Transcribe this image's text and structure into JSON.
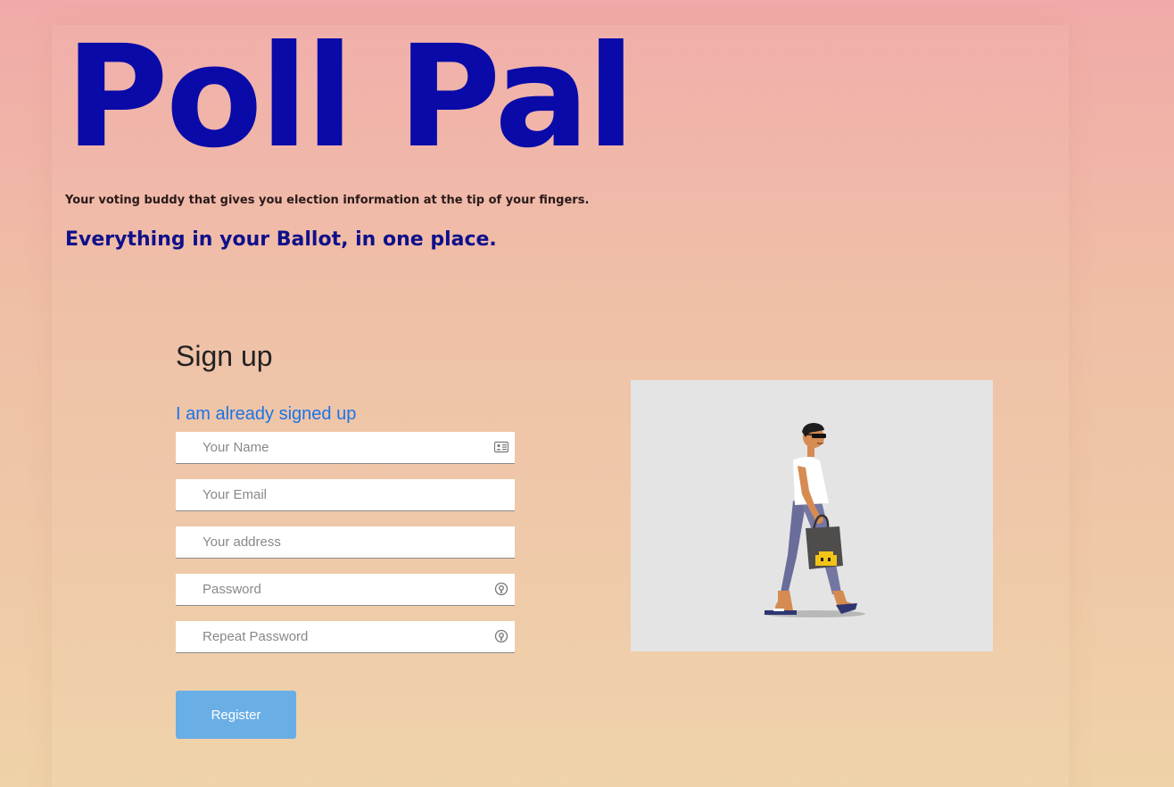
{
  "brand": {
    "title": "Poll Pal",
    "tagline": "Your voting buddy that gives you election information at the tip of your fingers.",
    "headline": "Everything in your Ballot, in one place."
  },
  "signup": {
    "title": "Sign up",
    "login_link": "I am already signed up",
    "fields": {
      "name": {
        "placeholder": "Your Name",
        "value": "",
        "icon": "contact-card-icon"
      },
      "email": {
        "placeholder": "Your Email",
        "value": ""
      },
      "address": {
        "placeholder": "Your address",
        "value": ""
      },
      "password": {
        "placeholder": "Password",
        "value": "",
        "icon": "password-reveal-icon"
      },
      "repeat_password": {
        "placeholder": "Repeat Password",
        "value": "",
        "icon": "password-reveal-icon"
      }
    },
    "register_label": "Register"
  },
  "illustration": {
    "subject": "walking-person-with-shopping-bag-illustration"
  },
  "colors": {
    "brand": "#0a0aa8",
    "headline": "#10108a",
    "link": "#1a73e8",
    "button": "#6aaee6",
    "background_top": "#f1aaa8",
    "background_bottom": "#efd2a8"
  }
}
